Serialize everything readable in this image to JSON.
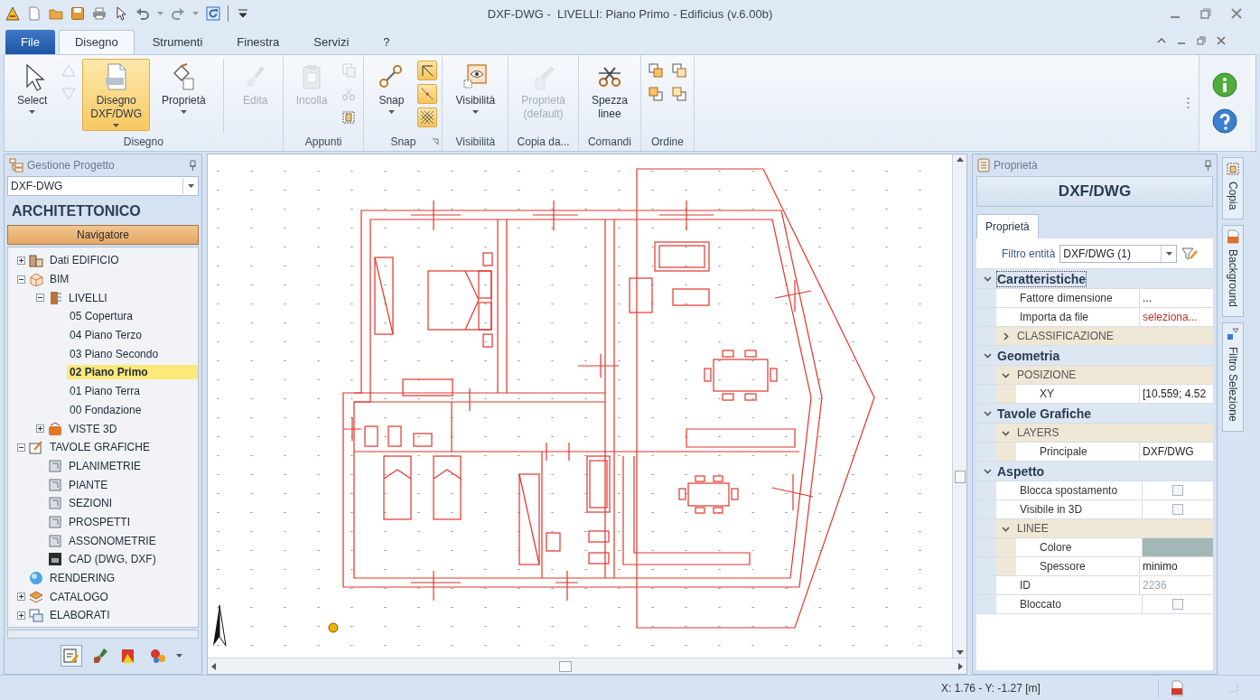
{
  "window": {
    "title": "DXF-DWG -  LIVELLI: Piano Primo - Edificius (v.6.00b)"
  },
  "menu_tabs": [
    {
      "label": "File",
      "kind": "file",
      "selected": false
    },
    {
      "label": "Disegno",
      "kind": "tab",
      "selected": true
    },
    {
      "label": "Strumenti",
      "kind": "tab",
      "selected": false
    },
    {
      "label": "Finestra",
      "kind": "tab",
      "selected": false
    },
    {
      "label": "Servizi",
      "kind": "tab",
      "selected": false
    },
    {
      "label": "?",
      "kind": "tab",
      "selected": false
    }
  ],
  "ribbon": {
    "groups": [
      {
        "label": "Disegno",
        "launcher": false,
        "items": [
          {
            "kind": "large",
            "label": "Select",
            "dropdown": true,
            "selected": false,
            "disabled": false
          },
          {
            "kind": "stack",
            "buttons": [
              {
                "on": false,
                "disabled": true
              },
              {
                "on": false,
                "disabled": true
              }
            ]
          },
          {
            "kind": "large",
            "label": "Disegno\nDXF/DWG",
            "dropdown": true,
            "selected": true,
            "disabled": false
          },
          {
            "kind": "large",
            "label": "Proprietà",
            "dropdown": true,
            "selected": false,
            "disabled": false
          },
          {
            "kind": "separator"
          },
          {
            "kind": "large",
            "label": "Edita",
            "dropdown": false,
            "selected": false,
            "disabled": true
          }
        ]
      },
      {
        "label": "Appunti",
        "launcher": false,
        "items": [
          {
            "kind": "large",
            "label": "Incolla",
            "dropdown": false,
            "selected": false,
            "disabled": true
          },
          {
            "kind": "stack",
            "buttons": [
              {
                "on": false,
                "disabled": true
              },
              {
                "on": false,
                "disabled": true
              },
              {
                "on": false,
                "disabled": false
              }
            ]
          }
        ]
      },
      {
        "label": "Snap",
        "launcher": true,
        "items": [
          {
            "kind": "large",
            "label": "Snap",
            "dropdown": true,
            "selected": false,
            "disabled": false
          },
          {
            "kind": "stack",
            "buttons": [
              {
                "on": true,
                "disabled": false
              },
              {
                "on": true,
                "disabled": false
              },
              {
                "on": true,
                "disabled": false
              }
            ]
          }
        ]
      },
      {
        "label": "Visibilità",
        "launcher": false,
        "items": [
          {
            "kind": "large",
            "label": "Visibilità",
            "dropdown": true,
            "selected": false,
            "disabled": false
          }
        ]
      },
      {
        "label": "Copia da...",
        "launcher": false,
        "items": [
          {
            "kind": "large",
            "label": "Proprietà\n(default)",
            "dropdown": false,
            "selected": false,
            "disabled": true
          }
        ]
      },
      {
        "label": "Comandi",
        "launcher": false,
        "items": [
          {
            "kind": "large",
            "label": "Spezza\nlinee",
            "dropdown": false,
            "selected": false,
            "disabled": false
          }
        ]
      },
      {
        "label": "Ordine",
        "launcher": false,
        "items": [
          {
            "kind": "stack",
            "buttons": [
              {
                "on": false,
                "disabled": false
              },
              {
                "on": false,
                "disabled": false
              }
            ]
          },
          {
            "kind": "stack",
            "buttons": [
              {
                "on": false,
                "disabled": false
              },
              {
                "on": false,
                "disabled": false
              }
            ]
          }
        ]
      }
    ]
  },
  "project_panel": {
    "title": "Gestione Progetto",
    "selector": "DXF-DWG",
    "heading": "ARCHITETTONICO",
    "navigator": "Navigatore",
    "tree": [
      {
        "label": "Dati EDIFICIO",
        "kind": "building",
        "expanded": false,
        "selected": false
      },
      {
        "label": "BIM",
        "kind": "bim",
        "expanded": true,
        "selected": false,
        "children": [
          {
            "label": "LIVELLI",
            "kind": "levels",
            "expanded": true,
            "selected": false,
            "children": [
              {
                "label": "05 Copertura",
                "selected": false
              },
              {
                "label": "04 Piano Terzo",
                "selected": false
              },
              {
                "label": "03 Piano Secondo",
                "selected": false
              },
              {
                "label": "02 Piano Primo",
                "selected": true
              },
              {
                "label": "01 Piano Terra",
                "selected": false
              },
              {
                "label": "00 Fondazione",
                "selected": false
              }
            ]
          },
          {
            "label": "VISTE 3D",
            "kind": "views",
            "expanded": false,
            "selected": false
          }
        ]
      },
      {
        "label": "TAVOLE GRAFICHE",
        "kind": "drawings",
        "expanded": true,
        "selected": false,
        "children": [
          {
            "label": "PLANIMETRIE",
            "kind": "sheet",
            "selected": false
          },
          {
            "label": "PIANTE",
            "kind": "sheet",
            "selected": false
          },
          {
            "label": "SEZIONI",
            "kind": "sheet",
            "selected": false
          },
          {
            "label": "PROSPETTI",
            "kind": "sheet",
            "selected": false
          },
          {
            "label": "ASSONOMETRIE",
            "kind": "sheet",
            "selected": false
          },
          {
            "label": "CAD (DWG, DXF)",
            "kind": "cad",
            "selected": false
          }
        ]
      },
      {
        "label": "RENDERING",
        "kind": "globe",
        "selected": false
      },
      {
        "label": "CATALOGO",
        "kind": "catalog",
        "expanded": false,
        "selected": false
      },
      {
        "label": "ELABORATI",
        "kind": "docs",
        "expanded": false,
        "selected": false
      }
    ],
    "toolbar": [
      {
        "selected": true
      },
      {
        "selected": false
      },
      {
        "selected": false
      },
      {
        "selected": false
      }
    ]
  },
  "properties_panel": {
    "title": "Proprietà",
    "heading": "DXF/DWG",
    "tabs": [
      {
        "label": "Proprietà",
        "selected": true
      }
    ],
    "filter": {
      "label": "Filtro entità",
      "value": "DXF/DWG (1)"
    },
    "categories": [
      {
        "label": "Caratteristiche",
        "expanded": true,
        "focused": true,
        "rows": [
          {
            "kind": "value",
            "label": "Fattore dimensione",
            "value": "...",
            "disabled": false
          },
          {
            "kind": "link",
            "label": "Importa da file",
            "value": "seleziona..."
          },
          {
            "kind": "group",
            "label": "CLASSIFICAZIONE",
            "expanded": false
          }
        ]
      },
      {
        "label": "Geometria",
        "expanded": true,
        "focused": false,
        "rows": [
          {
            "kind": "group",
            "label": "POSIZIONE",
            "expanded": true,
            "rows": [
              {
                "kind": "value",
                "label": "XY",
                "value": "[10.559; 4.52",
                "disabled": false
              }
            ]
          }
        ]
      },
      {
        "label": "Tavole Grafiche",
        "expanded": true,
        "focused": false,
        "rows": [
          {
            "kind": "group",
            "label": "LAYERS",
            "expanded": true,
            "rows": [
              {
                "kind": "value",
                "label": "Principale",
                "value": "DXF/DWG",
                "disabled": false
              }
            ]
          }
        ]
      },
      {
        "label": "Aspetto",
        "expanded": true,
        "focused": false,
        "rows": [
          {
            "kind": "check",
            "label": "Blocca spostamento",
            "checked": false
          },
          {
            "kind": "check",
            "label": "Visibile in 3D",
            "checked": false
          },
          {
            "kind": "group",
            "label": "LINEE",
            "expanded": true,
            "rows": [
              {
                "kind": "color",
                "label": "Colore",
                "color": "#a3b7b7"
              },
              {
                "kind": "value",
                "label": "Spessore",
                "value": "minimo",
                "disabled": false
              }
            ]
          },
          {
            "kind": "value",
            "label": "ID",
            "value": "2236",
            "disabled": true
          },
          {
            "kind": "check",
            "label": "Bloccato",
            "checked": false
          }
        ]
      }
    ]
  },
  "side_tabs": [
    {
      "label": "Copia"
    },
    {
      "label": "Background"
    },
    {
      "label": "Filtro Selezione"
    }
  ],
  "status_bar": {
    "coordinates": "X: 1.76 - Y: -1.27 [m]"
  }
}
